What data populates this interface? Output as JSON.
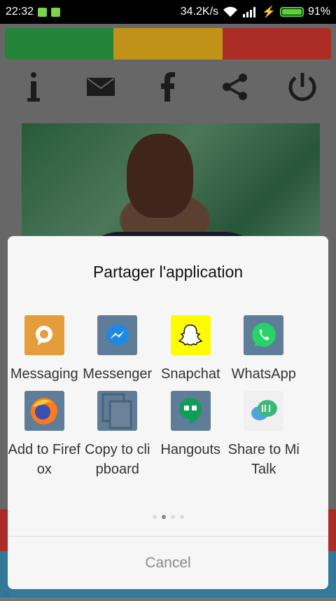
{
  "status_bar": {
    "time": "22:32",
    "speed": "34.2K/s",
    "battery": "91%"
  },
  "color_bar": [
    "#2a9a44",
    "#e2ad1d",
    "#c9362d"
  ],
  "toolbar": {
    "icons": [
      "info-icon",
      "mail-icon",
      "facebook-icon",
      "share-icon",
      "power-icon"
    ]
  },
  "share_sheet": {
    "title": "Partager  l'application",
    "apps_row1": [
      {
        "label": "Messaging",
        "icon": "messaging-icon",
        "color": "#e59c3b"
      },
      {
        "label": "Messenger",
        "icon": "messenger-icon",
        "color": "#5f7d98"
      },
      {
        "label": "Snapchat",
        "icon": "snapchat-icon",
        "color": "#fffc00"
      },
      {
        "label": "WhatsApp",
        "icon": "whatsapp-icon",
        "color": "#5f7d98"
      }
    ],
    "apps_row2": [
      {
        "label": "Add to Firefox",
        "icon": "firefox-icon",
        "color": "#5f7d98"
      },
      {
        "label": "Copy to clipboard",
        "icon": "clipboard-icon",
        "color": "#5f7d98"
      },
      {
        "label": "Hangouts",
        "icon": "hangouts-icon",
        "color": "#5f7d98"
      },
      {
        "label": "Share to Mi Talk",
        "icon": "mi-talk-icon",
        "color": "#f0f0f0"
      }
    ],
    "page_dots": 4,
    "active_dot": 2,
    "cancel_label": "Cancel"
  }
}
